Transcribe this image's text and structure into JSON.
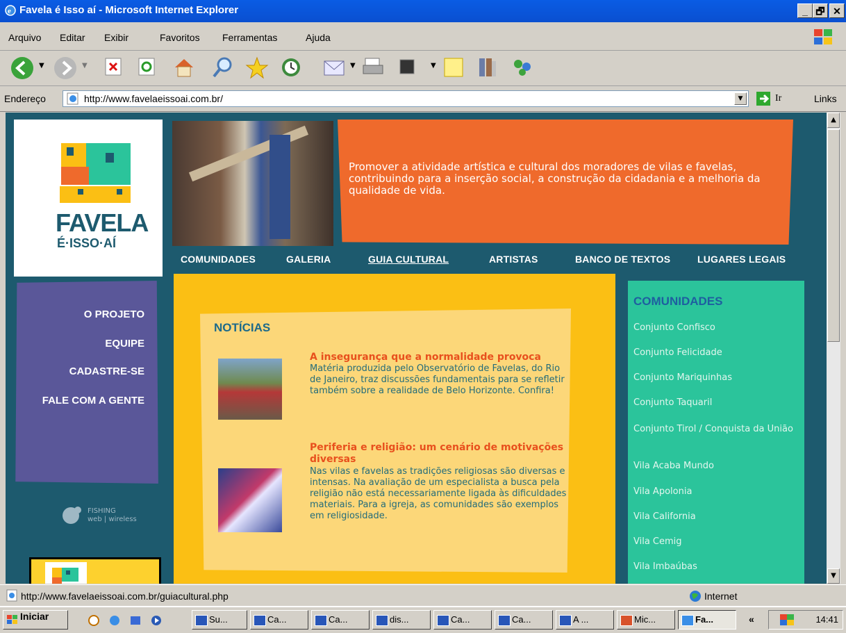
{
  "window": {
    "title": "Favela é Isso aí - Microsoft Internet Explorer",
    "controls": [
      "_",
      "🗗",
      "✕"
    ]
  },
  "menu": [
    "Arquivo",
    "Editar",
    "Exibir",
    "Favoritos",
    "Ferramentas",
    "Ajuda"
  ],
  "address": {
    "label": "Endereço",
    "url": "http://www.favelaeissoai.com.br/",
    "go_label": "Ir",
    "links_label": "Links"
  },
  "site": {
    "logo_text_1": "FAVELA",
    "logo_text_2": "É·ISSO·AÍ",
    "mission": "Promover a atividade artística e cultural dos moradores de vilas e favelas, contribuindo para a inserção social, a construção da cidadania e a melhoria da qualidade de vida.",
    "top_nav": [
      "COMUNIDADES",
      "GALERIA",
      "GUIA CULTURAL",
      "ARTISTAS",
      "BANCO DE TEXTOS",
      "LUGARES LEGAIS"
    ],
    "side_nav": [
      "O PROJETO",
      "EQUIPE",
      "CADASTRE-SE",
      "FALE COM A GENTE"
    ],
    "fishing_line_1": "FISHING",
    "fishing_line_2": "web | wireless",
    "news_title": "NOTÍCIAS",
    "news": [
      {
        "headline": "A insegurança que a normalidade provoca",
        "body": "Matéria produzida pelo Observatório de Favelas, do Rio de Janeiro, traz discussões fundamentais para se refletir também sobre a realidade de Belo Horizonte. Confira!"
      },
      {
        "headline": "Periferia e religião: um cenário de motivações diversas",
        "body": "Nas vilas e favelas as tradições religiosas são diversas e intensas. Na avaliação de um especialista a busca pela religião não está necessariamente ligada às dificuldades materiais. Para a igreja, as comunidades são exemplos em religiosidade."
      }
    ],
    "communities_title": "COMUNIDADES",
    "communities": [
      "Conjunto Confisco",
      "Conjunto Felicidade",
      "Conjunto Mariquinhas",
      "Conjunto Taquaril",
      "Conjunto Tirol / Conquista da União",
      "Vila Acaba Mundo",
      "Vila Apolonia",
      "Vila California",
      "Vila Cemig",
      "Vila Imbaúbas"
    ]
  },
  "status": {
    "text": "http://www.favelaeissoai.com.br/guiacultural.php",
    "zone": "Internet"
  },
  "taskbar": {
    "start": "Iniciar",
    "tasks": [
      "Su...",
      "Ca...",
      "Ca...",
      "dis...",
      "Ca...",
      "Ca...",
      "A ...",
      "Mic...",
      "Fa..."
    ],
    "chevron": "«",
    "clock": "14:41"
  },
  "colors": {
    "page_bg": "#1d5a6e",
    "orange": "#ef6a2c",
    "yellow": "#fbbf14",
    "green": "#2bc49b",
    "purple": "#5a5799"
  }
}
